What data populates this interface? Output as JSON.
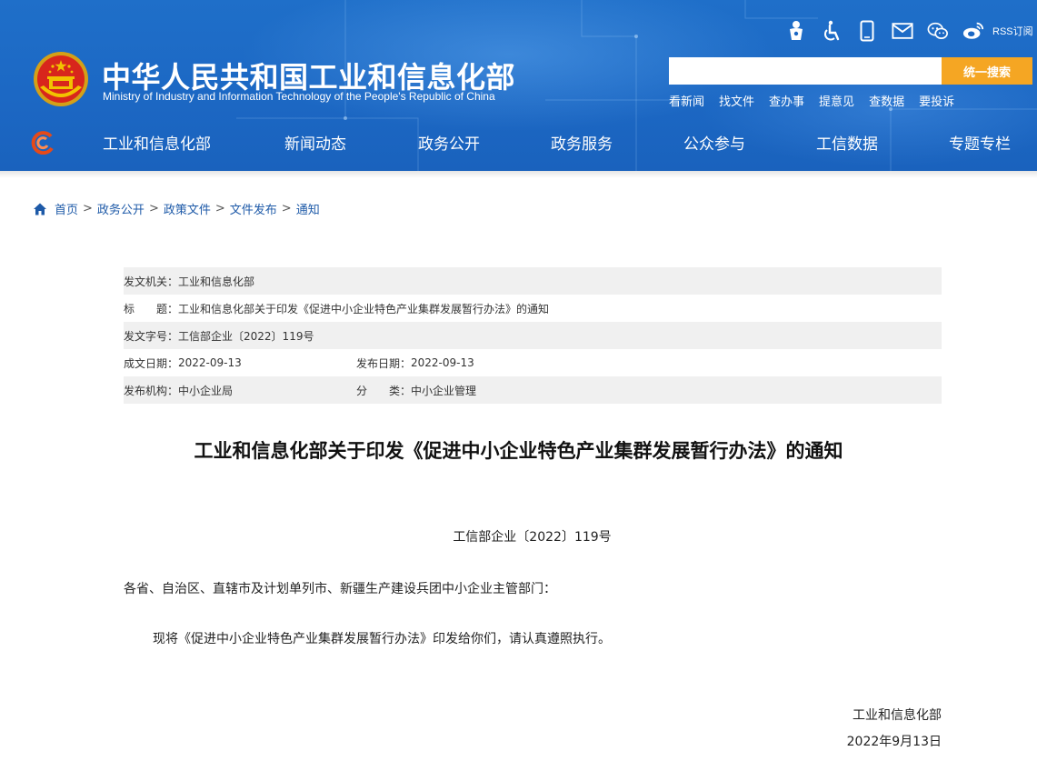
{
  "header": {
    "site_title": "中华人民共和国工业和信息化部",
    "site_subtitle": "Ministry of Industry and Information Technology of the People's Republic of China",
    "utility_icons": [
      "elderly-mode-icon",
      "accessibility-icon",
      "mobile-icon",
      "email-icon",
      "wechat-icon",
      "weibo-icon",
      "rss-icon"
    ],
    "rss_label": "RSS订阅",
    "search_placeholder": "",
    "search_button": "统一搜索",
    "quick_links": [
      "看新闻",
      "找文件",
      "查办事",
      "提意见",
      "查数据",
      "要投诉"
    ],
    "nav": [
      "工业和信息化部",
      "新闻动态",
      "政务公开",
      "政务服务",
      "公众参与",
      "工信数据",
      "专题专栏"
    ]
  },
  "breadcrumb": {
    "items": [
      "首页",
      "政务公开",
      "政策文件",
      "文件发布",
      "通知"
    ],
    "separator": ">"
  },
  "meta": {
    "issuing_org_label": "发文机关：",
    "issuing_org": "工业和信息化部",
    "title_label": "标　　题：",
    "title": "工业和信息化部关于印发《促进中小企业特色产业集群发展暂行办法》的通知",
    "doc_no_label": "发文字号：",
    "doc_no": "工信部企业〔2022〕119号",
    "written_date_label": "成文日期：",
    "written_date": "2022-09-13",
    "publish_date_label": "发布日期：",
    "publish_date": "2022-09-13",
    "publisher_label": "发布机构：",
    "publisher": "中小企业局",
    "category_label": "分　　类：",
    "category": "中小企业管理"
  },
  "article": {
    "title": "工业和信息化部关于印发《促进中小企业特色产业集群发展暂行办法》的通知",
    "doc_number": "工信部企业〔2022〕119号",
    "addressee": "各省、自治区、直辖市及计划单列市、新疆生产建设兵团中小企业主管部门：",
    "body": "现将《促进中小企业特色产业集群发展暂行办法》印发给你们，请认真遵照执行。",
    "issuer": "工业和信息化部",
    "date": "2022年9月13日"
  },
  "colors": {
    "header_blue": "#1c68c4",
    "search_button": "#f5a623",
    "link_blue": "#1e5aa8",
    "table_shade": "#f0f0f0"
  }
}
